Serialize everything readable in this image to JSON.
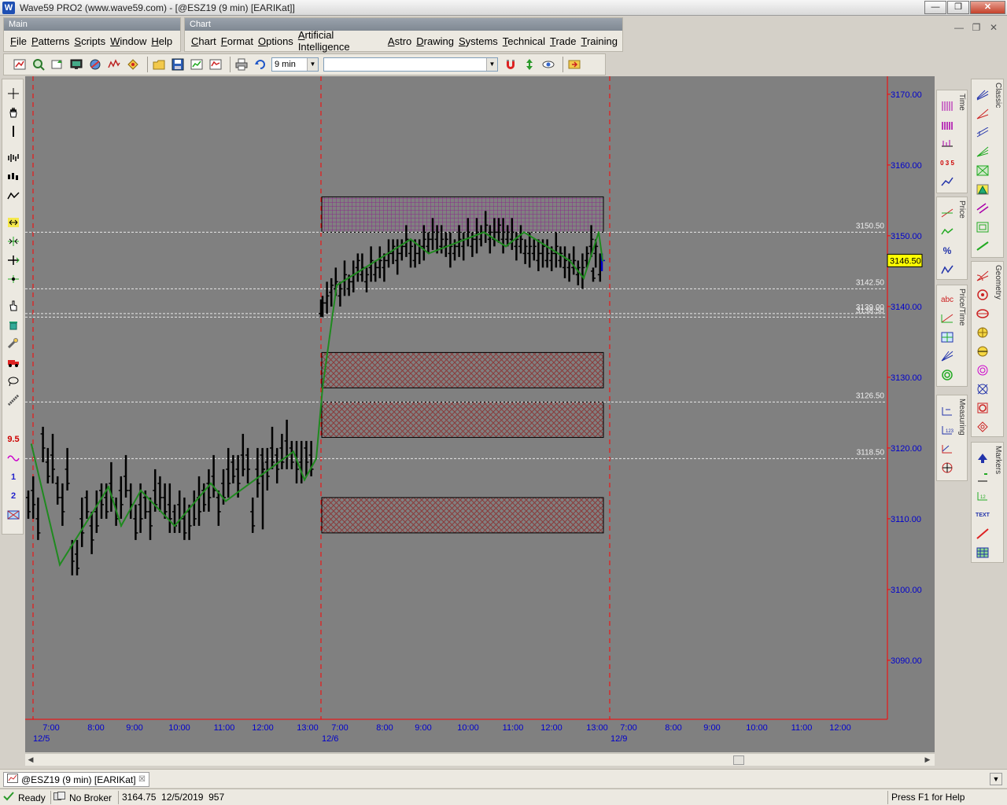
{
  "window": {
    "title": "Wave59 PRO2 (www.wave59.com) - [@ESZ19 (9 min) [EARIKat]]",
    "logo_letter": "W",
    "min_glyph": "—",
    "restore_glyph": "❐",
    "close_glyph": "✕"
  },
  "main_menu": {
    "caption": "Main",
    "items": [
      {
        "key": "F",
        "rest": "ile"
      },
      {
        "key": "P",
        "rest": "atterns"
      },
      {
        "key": "S",
        "rest": "cripts"
      },
      {
        "key": "W",
        "rest": "indow"
      },
      {
        "key": "H",
        "rest": "elp"
      }
    ]
  },
  "chart_menu": {
    "caption": "Chart",
    "items": [
      {
        "key": "C",
        "rest": "hart"
      },
      {
        "key": "F",
        "rest": "ormat"
      },
      {
        "key": "O",
        "rest": "ptions"
      },
      {
        "key": "A",
        "rest": "rtificial Intelligence"
      },
      {
        "key": "A",
        "rest": "stro"
      },
      {
        "key": "D",
        "rest": "rawing"
      },
      {
        "key": "S",
        "rest": "ystems"
      },
      {
        "key": "T",
        "rest": "echnical"
      },
      {
        "key": "T",
        "rest": "rade"
      },
      {
        "key": "T",
        "rest": "raining"
      }
    ]
  },
  "mdi_controls": {
    "min": "—",
    "restore": "❐",
    "close": "✕"
  },
  "toolbar": {
    "interval_value": "9 min",
    "symbol_value": "",
    "dropdown_glyph": "▼"
  },
  "chart": {
    "price_ticks": [
      "3170.00",
      "3160.00",
      "3150.00",
      "3140.00",
      "3130.00",
      "3120.00",
      "3110.00",
      "3100.00",
      "3090.00"
    ],
    "current_price": "3146.50",
    "level_lines": [
      {
        "price": 3150.5,
        "label": "3150.50"
      },
      {
        "price": 3142.5,
        "label": "3142.50"
      },
      {
        "price": 3139.0,
        "label": "3139.00"
      },
      {
        "price": 3138.5,
        "label": "3138.50"
      },
      {
        "price": 3126.5,
        "label": "3126.50"
      },
      {
        "price": 3118.5,
        "label": "3118.50"
      }
    ],
    "zones": [
      {
        "top": 3155.5,
        "bottom": 3150.5,
        "type": "resistance",
        "color": "#8a2b8a"
      },
      {
        "top": 3133.5,
        "bottom": 3128.5,
        "type": "support",
        "color": "#8a3a3a"
      },
      {
        "top": 3126.5,
        "bottom": 3121.5,
        "type": "support",
        "color": "#8a3a3a"
      },
      {
        "top": 3113.0,
        "bottom": 3108.0,
        "type": "support",
        "color": "#8a3a3a"
      }
    ],
    "time_ticks": [
      "7:00",
      "8:00",
      "9:00",
      "10:00",
      "11:00",
      "12:00",
      "13:00",
      "7:00",
      "8:00",
      "9:00",
      "10:00",
      "11:00",
      "12:00",
      "13:00",
      "7:00",
      "8:00",
      "9:00",
      "10:00",
      "11:00",
      "12:00"
    ],
    "dates": [
      "12/5",
      "12/6",
      "12/9"
    ],
    "colors": {
      "background": "#808080",
      "wave": "#1f8a1f",
      "bars": "#000000",
      "axis_text": "#0000cc",
      "session_line": "#ff0000",
      "price_flag": "#ffff00"
    }
  },
  "chart_data": {
    "type": "bar",
    "x": [
      "12/5 7:00",
      "12/5 13:00",
      "12/6 7:00",
      "12/6 13:00"
    ],
    "ylim": [
      3080,
      3172
    ],
    "zigzag": [
      3120.5,
      3103.5,
      3114.5,
      3109.0,
      3114.0,
      3109.0,
      3115.0,
      3112.5,
      3119.5,
      3115.5,
      3118.5,
      3128.5,
      3143.0,
      3149.5,
      3147.5,
      3150.5,
      3148.5,
      3150.5,
      3146.5,
      3144.0,
      3150.5,
      3146.5
    ]
  },
  "doc_tab": {
    "label": "@ESZ19 (9 min) [EARIKat]",
    "close": "☒",
    "menu": "▼"
  },
  "status": {
    "ready": "Ready",
    "broker": "No Broker",
    "cursor_info": "3164.75  12/5/2019  957",
    "help": "Press F1 for Help"
  },
  "right_panels": {
    "classic": "Classic",
    "time": "Time",
    "price": "Price",
    "geometry": "Geometry",
    "price_time": "Price/Time",
    "measuring": "Measuring",
    "markers": "Markers",
    "fib_label": "0 3 5",
    "abc_label": "abc",
    "percent_label": "%",
    "text_label": "TEXT",
    "n95_label": "9.5",
    "n1_label": "1",
    "n2_label": "2"
  }
}
